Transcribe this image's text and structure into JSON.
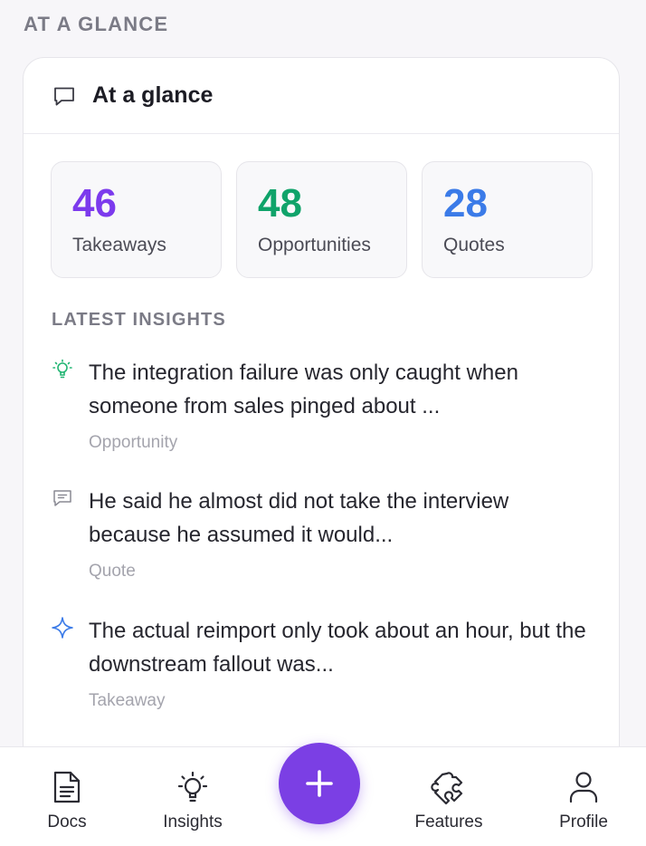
{
  "section_heading": "AT A GLANCE",
  "card": {
    "title": "At a glance",
    "header_icon": "chat-bubble-icon"
  },
  "stats": [
    {
      "value": "46",
      "label": "Takeaways",
      "color": "#7c3aed"
    },
    {
      "value": "48",
      "label": "Opportunities",
      "color": "#10a36a"
    },
    {
      "value": "28",
      "label": "Quotes",
      "color": "#3b7be8"
    }
  ],
  "latest_insights": {
    "heading": "LATEST INSIGHTS",
    "items": [
      {
        "text": "The integration failure was only caught when someone from sales pinged about ...",
        "type": "Opportunity",
        "icon": "lightbulb-icon",
        "icon_color": "#22b573"
      },
      {
        "text": "He said he almost did not take the interview because he assumed it would...",
        "type": "Quote",
        "icon": "quote-bubble-icon",
        "icon_color": "#8a8a94"
      },
      {
        "text": "The actual reimport only took about an hour, but the downstream fallout was...",
        "type": "Takeaway",
        "icon": "sparkle-icon",
        "icon_color": "#3b7be8"
      }
    ]
  },
  "bottom_nav": {
    "items": [
      {
        "label": "Docs",
        "icon": "document-icon"
      },
      {
        "label": "Insights",
        "icon": "lightbulb-icon"
      },
      {
        "label": "Features",
        "icon": "puzzle-icon"
      },
      {
        "label": "Profile",
        "icon": "user-icon"
      }
    ],
    "fab_icon": "plus-icon",
    "fab_color": "#7b3fe4"
  }
}
